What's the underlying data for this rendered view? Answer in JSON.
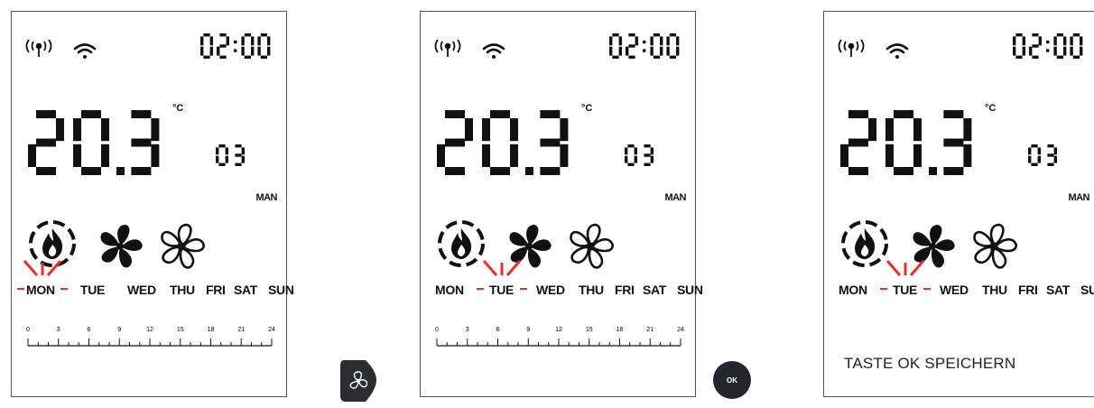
{
  "panels": [
    {
      "clock": "02:00",
      "temperature": "20.3",
      "unit": "°C",
      "program": "03",
      "mode": "MAN",
      "days": [
        "MON",
        "TUE",
        "WED",
        "THU",
        "FRI",
        "SAT",
        "SUN"
      ],
      "selected_day": "MON",
      "timeline_labels": [
        "0",
        "3",
        "6",
        "9",
        "12",
        "15",
        "18",
        "21",
        "24"
      ]
    },
    {
      "clock": "02:00",
      "temperature": "20.3",
      "unit": "°C",
      "program": "03",
      "mode": "MAN",
      "days": [
        "MON",
        "TUE",
        "WED",
        "THU",
        "FRI",
        "SAT",
        "SUN"
      ],
      "selected_day": "TUE",
      "timeline_labels": [
        "0",
        "3",
        "6",
        "9",
        "12",
        "15",
        "18",
        "21",
        "24"
      ]
    },
    {
      "clock": "02:00",
      "temperature": "20.3",
      "unit": "°C",
      "program": "03",
      "mode": "MAN",
      "days": [
        "MON",
        "TUE",
        "WED",
        "THU",
        "FRI",
        "SAT",
        "SUN"
      ],
      "selected_day": "TUE",
      "caption": "TASTE OK SPEICHERN"
    }
  ],
  "buttons": {
    "fan_icon": "fan-icon",
    "ok_label": "OK"
  },
  "colors": {
    "segment": "#111111",
    "highlight": "#e8302a",
    "ok_button": "#23262b"
  }
}
